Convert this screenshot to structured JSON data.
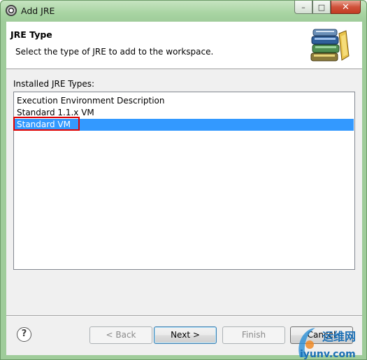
{
  "window": {
    "title": "Add JRE",
    "controls": {
      "minimize": "–",
      "maximize": "□",
      "close": "✕"
    }
  },
  "header": {
    "title": "JRE Type",
    "description": "Select the type of JRE to add to the workspace.",
    "icon": "jre-library-books-icon"
  },
  "installed": {
    "label": "Installed JRE Types:",
    "items": [
      {
        "label": "Execution Environment Description",
        "selected": false
      },
      {
        "label": "Standard 1.1.x VM",
        "selected": false
      },
      {
        "label": "Standard VM",
        "selected": true
      }
    ]
  },
  "buttons": {
    "help": "?",
    "back": "< Back",
    "next": "Next >",
    "finish": "Finish",
    "cancel": "Cancel"
  },
  "watermark": {
    "text": "iyunv.com",
    "cn_text": "运维网"
  },
  "colors": {
    "selection": "#3399ff",
    "highlight_box": "#e00000",
    "title_bar": "#a8d4a2"
  }
}
